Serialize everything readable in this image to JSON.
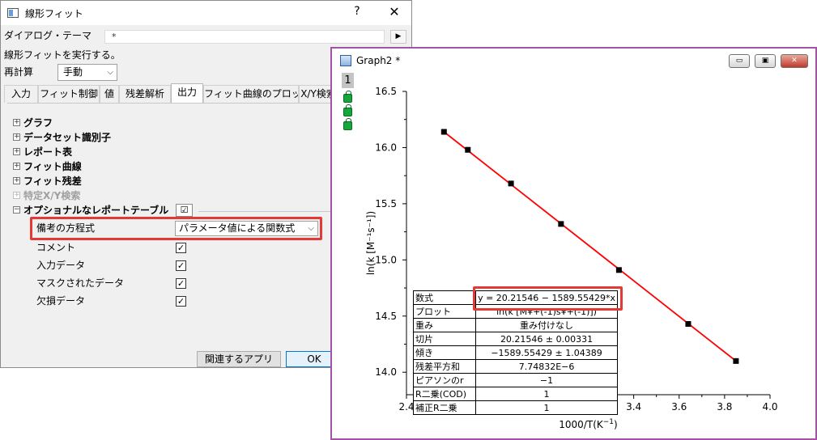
{
  "dialog": {
    "title": "線形フィット",
    "help_label": "?",
    "close_label": "✕",
    "theme_label": "ダイアログ・テーマ",
    "theme_value": "*",
    "theme_arrow": "▶",
    "description": "線形フィットを実行する。",
    "recalc_label": "再計算",
    "recalc_value": "手動",
    "tabs": [
      "入力",
      "フィット制御",
      "値",
      "残差解析",
      "出力",
      "フィット曲線のプロット",
      "X/Y検索"
    ],
    "active_tab": "出力",
    "tree": [
      {
        "label": "グラフ",
        "expander": "+",
        "enabled": true
      },
      {
        "label": "データセット識別子",
        "expander": "+",
        "enabled": true
      },
      {
        "label": "レポート表",
        "expander": "+",
        "enabled": true
      },
      {
        "label": "フィット曲線",
        "expander": "+",
        "enabled": true
      },
      {
        "label": "フィット残差",
        "expander": "+",
        "enabled": true
      },
      {
        "label": "特定X/Y検索",
        "expander": "+",
        "enabled": false
      },
      {
        "label": "オプショナルなレポートテーブル",
        "expander": "−",
        "enabled": true
      }
    ],
    "optional_checked": "☑",
    "equation_label": "備考の方程式",
    "equation_value": "パラメータ値による関数式",
    "subitems": [
      {
        "label": "コメント",
        "checked": "✓"
      },
      {
        "label": "入力データ",
        "checked": "✓"
      },
      {
        "label": "マスクされたデータ",
        "checked": "✓"
      },
      {
        "label": "欠損データ",
        "checked": "✓"
      }
    ],
    "btn_related": "関連するアプリ",
    "btn_ok": "OK"
  },
  "graph": {
    "title": "Graph2 *",
    "layer": "1",
    "min_label": "▭",
    "max_label": "▣",
    "close_label": "✕",
    "xlabel": "1000/T(K",
    "xlabel_sup": "−1",
    "xlabel_end": ")",
    "ylabel": "ln(k [M⁻¹s⁻¹])",
    "table": [
      {
        "key": "数式",
        "value": "y = 20.21546 − 1589.55429*x"
      },
      {
        "key": "プロット",
        "value": "ln(k [M¥+(-1)s¥+(-1)])"
      },
      {
        "key": "重み",
        "value": "重み付けなし"
      },
      {
        "key": "切片",
        "value": "20.21546 ± 0.00331"
      },
      {
        "key": "傾き",
        "value": "−1589.55429 ± 1.04389"
      },
      {
        "key": "残差平方和",
        "value": "7.74832E−6"
      },
      {
        "key": "ピアソンのr",
        "value": "−1"
      },
      {
        "key": "R二乗(COD)",
        "value": "1"
      },
      {
        "key": "補正R二乗",
        "value": "1"
      }
    ]
  },
  "chart_data": {
    "type": "scatter",
    "xlim": [
      2.4,
      4.0
    ],
    "ylim": [
      13.8,
      16.5
    ],
    "xticks": [
      "2.4",
      "2.6",
      "2.8",
      "3.0",
      "3.2",
      "3.4",
      "3.6",
      "3.8",
      "4.0"
    ],
    "yticks": [
      "14.0",
      "14.5",
      "15.0",
      "15.5",
      "16.0",
      "16.5"
    ],
    "points_x": [
      2.565,
      2.67,
      2.86,
      3.08,
      3.335,
      3.64,
      3.85
    ],
    "points_y": [
      16.14,
      15.98,
      15.68,
      15.32,
      14.91,
      14.43,
      14.1
    ],
    "line_x": [
      2.565,
      3.85
    ],
    "line_y": [
      16.14,
      14.1
    ],
    "marker_color": "#000000",
    "line_color": "#ff0000"
  }
}
